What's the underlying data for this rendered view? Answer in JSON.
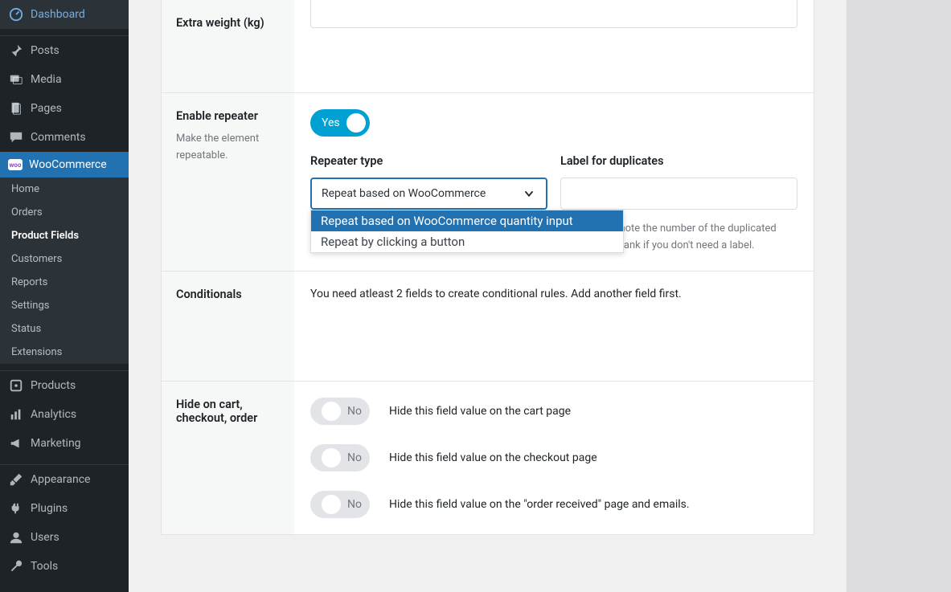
{
  "sidebar": {
    "items": [
      {
        "label": "Dashboard"
      },
      {
        "label": "Posts"
      },
      {
        "label": "Media"
      },
      {
        "label": "Pages"
      },
      {
        "label": "Comments"
      },
      {
        "label": "WooCommerce"
      },
      {
        "label": "Products"
      },
      {
        "label": "Analytics"
      },
      {
        "label": "Marketing"
      },
      {
        "label": "Appearance"
      },
      {
        "label": "Plugins"
      },
      {
        "label": "Users"
      },
      {
        "label": "Tools"
      }
    ],
    "submenu": [
      {
        "label": "Home"
      },
      {
        "label": "Orders"
      },
      {
        "label": "Product Fields"
      },
      {
        "label": "Customers"
      },
      {
        "label": "Reports"
      },
      {
        "label": "Settings"
      },
      {
        "label": "Status"
      },
      {
        "label": "Extensions"
      }
    ]
  },
  "form": {
    "extra_weight": {
      "label": "Extra weight (kg)"
    },
    "enable_repeater": {
      "label": "Enable repeater",
      "desc": "Make the element repeatable.",
      "toggle": "Yes"
    },
    "repeater_type": {
      "label": "Repeater type",
      "selected": "Repeat based on WooCommerce",
      "options": [
        "Repeat based on WooCommerce quantity input",
        "Repeat by clicking a button"
      ]
    },
    "label_dup": {
      "label": "Label for duplicates",
      "help": "Use {n} to denote the number of the duplicated field. Leave blank if you don't need a label."
    },
    "conditionals": {
      "label": "Conditionals",
      "text": "You need atleast 2 fields to create conditional rules. Add another field first."
    },
    "hide": {
      "label": "Hide on cart, checkout, order",
      "toggle": "No",
      "rows": [
        "Hide this field value on the cart page",
        "Hide this field value on the checkout page",
        "Hide this field value on the \"order received\" page and emails."
      ]
    }
  }
}
